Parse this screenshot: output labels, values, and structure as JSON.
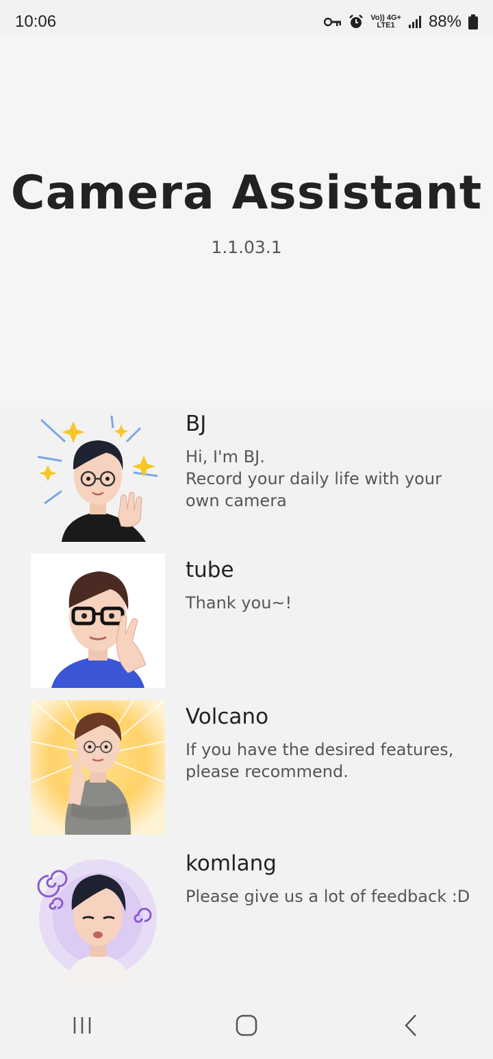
{
  "status_bar": {
    "time": "10:06",
    "network_top": "Vo)) 4G+",
    "network_bottom": "LTE1",
    "battery": "88%",
    "icons": [
      "vpn-key-icon",
      "alarm-icon",
      "signal-icon",
      "battery-icon"
    ]
  },
  "app": {
    "title": "Camera Assistant",
    "version": "1.1.03.1"
  },
  "developers": [
    {
      "name": "BJ",
      "message": "Hi, I'm BJ.\nRecord your daily life with your own camera"
    },
    {
      "name": "tube",
      "message": "Thank you~!"
    },
    {
      "name": "Volcano",
      "message": "If you have the desired features, please recommend."
    },
    {
      "name": "komlang",
      "message": "Please give us a lot of feedback :D"
    }
  ],
  "nav": {
    "icons": [
      "recent-apps-icon",
      "home-icon",
      "back-icon"
    ]
  }
}
